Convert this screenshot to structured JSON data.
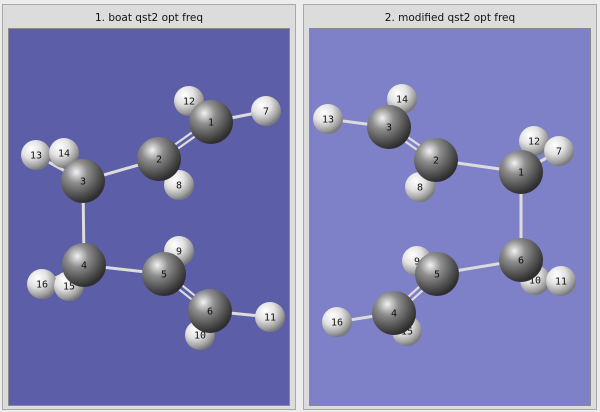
{
  "panels": [
    {
      "title": "1.  boat qst2 opt freq",
      "atoms": [
        {
          "label": "12",
          "element": "H"
        },
        {
          "label": "1",
          "element": "C"
        },
        {
          "label": "7",
          "element": "H"
        },
        {
          "label": "13",
          "element": "H"
        },
        {
          "label": "14",
          "element": "H"
        },
        {
          "label": "3",
          "element": "C"
        },
        {
          "label": "2",
          "element": "C"
        },
        {
          "label": "8",
          "element": "H"
        },
        {
          "label": "9",
          "element": "H"
        },
        {
          "label": "4",
          "element": "C"
        },
        {
          "label": "5",
          "element": "C"
        },
        {
          "label": "16",
          "element": "H"
        },
        {
          "label": "15",
          "element": "H"
        },
        {
          "label": "6",
          "element": "C"
        },
        {
          "label": "11",
          "element": "H"
        },
        {
          "label": "10",
          "element": "H"
        }
      ]
    },
    {
      "title": "2.  modified qst2 opt freq",
      "atoms": [
        {
          "label": "14",
          "element": "H"
        },
        {
          "label": "13",
          "element": "H"
        },
        {
          "label": "3",
          "element": "C"
        },
        {
          "label": "12",
          "element": "H"
        },
        {
          "label": "7",
          "element": "H"
        },
        {
          "label": "2",
          "element": "C"
        },
        {
          "label": "1",
          "element": "C"
        },
        {
          "label": "8",
          "element": "H"
        },
        {
          "label": "9",
          "element": "H"
        },
        {
          "label": "6",
          "element": "C"
        },
        {
          "label": "5",
          "element": "C"
        },
        {
          "label": "10",
          "element": "H"
        },
        {
          "label": "11",
          "element": "H"
        },
        {
          "label": "16",
          "element": "H"
        },
        {
          "label": "4",
          "element": "C"
        },
        {
          "label": "15",
          "element": "H"
        }
      ]
    }
  ],
  "colors": {
    "left_background": "#5c5ea8",
    "right_background": "#7e80c8",
    "carbon": "#7a7a7a",
    "hydrogen": "#e6e6e6",
    "bond": "#dcdcdc"
  }
}
